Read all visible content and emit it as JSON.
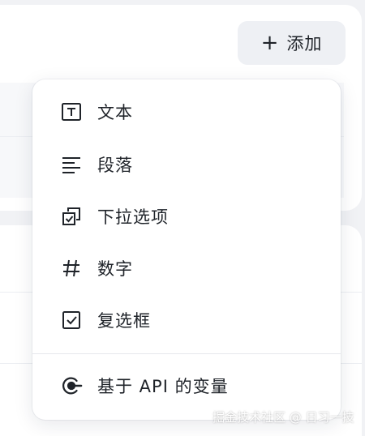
{
  "add_button": {
    "icon": "plus-icon",
    "label": "添加"
  },
  "menu": {
    "items": [
      {
        "label": "文本",
        "icon": "text-icon"
      },
      {
        "label": "段落",
        "icon": "paragraph-icon"
      },
      {
        "label": "下拉选项",
        "icon": "dropdown-icon"
      },
      {
        "label": "数字",
        "icon": "hash-icon"
      },
      {
        "label": "复选框",
        "icon": "checkbox-icon"
      },
      {
        "label": "基于 API 的变量",
        "icon": "api-icon"
      }
    ]
  },
  "watermark": "掘金技术社区 @ 日习一技"
}
